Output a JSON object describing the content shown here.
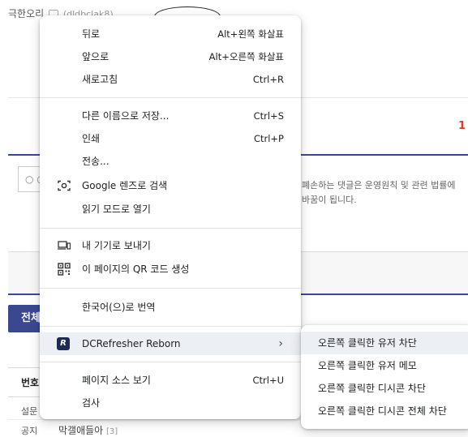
{
  "background": {
    "username": "극한오리",
    "user_id": "(dldbclak8)",
    "comment_count": "1",
    "comment_placeholder": "○ ○",
    "notice_line1": "폐손하는 댓글은 운영원칙 및 관련 법률에",
    "notice_line2": "바꿈이 됩니다.",
    "button_label": "전체",
    "table_header": "번호",
    "row1_label": "설문",
    "row2_label": "공지",
    "row2_title": "막갤애들아",
    "row2_count": "[3]"
  },
  "context_menu": {
    "items": [
      {
        "label": "뒤로",
        "shortcut": "Alt+왼쪽 화살표"
      },
      {
        "label": "앞으로",
        "shortcut": "Alt+오른쪽 화살표"
      },
      {
        "label": "새로고침",
        "shortcut": "Ctrl+R"
      },
      {
        "label": "다른 이름으로 저장...",
        "shortcut": "Ctrl+S"
      },
      {
        "label": "인쇄",
        "shortcut": "Ctrl+P"
      },
      {
        "label": "전송..."
      },
      {
        "label": "Google 렌즈로 검색",
        "icon": "google-lens-icon"
      },
      {
        "label": "읽기 모드로 열기"
      },
      {
        "label": "내 기기로 보내기",
        "icon": "devices-icon"
      },
      {
        "label": "이 페이지의 QR 코드 생성",
        "icon": "qr-code-icon"
      },
      {
        "label": "한국어(으)로 번역"
      },
      {
        "label": "DCRefresher Reborn",
        "icon": "dcrefresher-icon",
        "icon_text": "R"
      },
      {
        "label": "페이지 소스 보기",
        "shortcut": "Ctrl+U"
      },
      {
        "label": "검사"
      }
    ],
    "submenu_arrow": "›"
  },
  "submenu": {
    "items": [
      {
        "label": "오른쪽 클릭한 유저 차단"
      },
      {
        "label": "오른쪽 클릭한 유저 메모"
      },
      {
        "label": "오른쪽 클릭한 디시콘 차단"
      },
      {
        "label": "오른쪽 클릭한 디시콘 전체 차단"
      }
    ]
  },
  "colors": {
    "accent": "#3b4890",
    "highlight": "#eceff3",
    "count_red": "#d3402b"
  }
}
